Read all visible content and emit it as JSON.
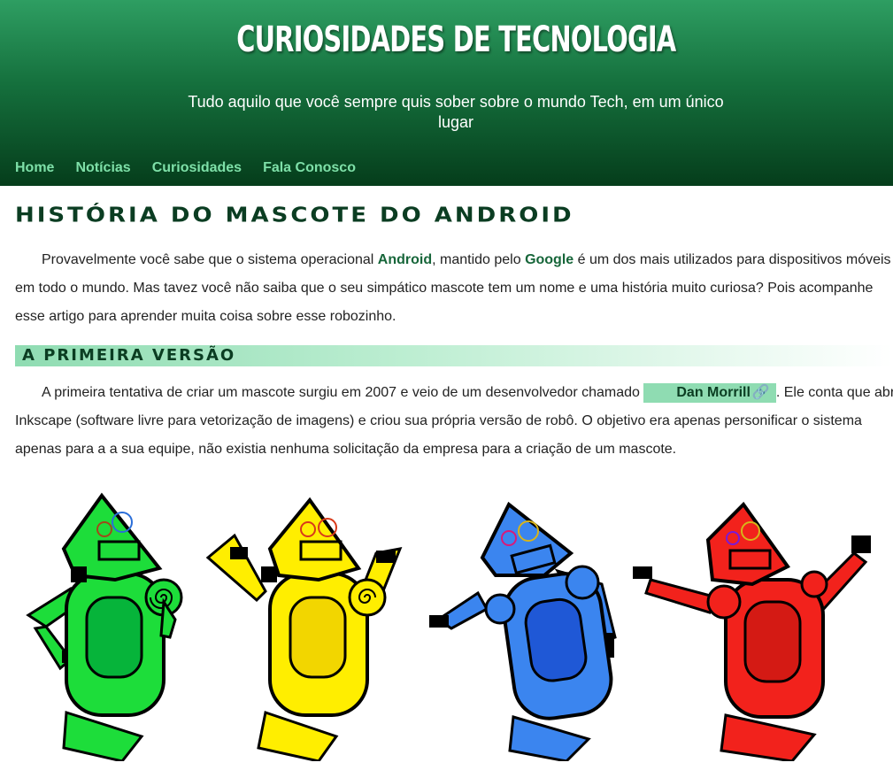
{
  "header": {
    "title": "CURIOSIDADES DE TECNOLOGIA",
    "subtitle": "Tudo aquilo que você sempre quis sober sobre o mundo Tech, em um único lugar"
  },
  "nav": {
    "items": [
      {
        "label": "Home"
      },
      {
        "label": "Notícias"
      },
      {
        "label": "Curiosidades"
      },
      {
        "label": "Fala Conosco"
      }
    ]
  },
  "article": {
    "title": "HISTÓRIA DO MASCOTE DO ANDROID",
    "intro": {
      "line1_a": "Provavelmente você sabe que o sistema operacional ",
      "line1_b": "Android",
      "line1_c": ", mantido pelo ",
      "line1_d": "Google",
      "line1_e": " é um dos mais utilizados para dispositivos móveis",
      "line2": "em todo o mundo. Mas tavez você não saiba que o seu simpático mascote tem um nome e uma história muito curiosa? Pois acompanhe",
      "line3": "esse artigo para aprender muita coisa sobre esse robozinho."
    },
    "section1": {
      "heading": "A PRIMEIRA VERSÃO",
      "line1_a": "A primeira tentativa de criar um mascote surgiu em 2007 e veio de um desenvolvedor chamado ",
      "link_label": "Dan Morrill",
      "line1_b": ". Ele conta que abriu o",
      "line2": "Inkscape (software livre para vetorização de imagens) e criou sua própria versão de robô. O objetivo era apenas personificar o sistema",
      "line3": "apenas para a a sua equipe, não existia nenhuma solicitação da empresa para a criação de um mascote."
    },
    "robots": [
      {
        "color": "#1ddd3a",
        "dark": "#0ba32b",
        "visor": "#06b43a"
      },
      {
        "color": "#ffee00",
        "dark": "#d8c400",
        "visor": "#f2d600"
      },
      {
        "color": "#3b85ef",
        "dark": "#2a63c4",
        "visor": "#1f58d6"
      },
      {
        "color": "#f2221c",
        "dark": "#c4150f",
        "visor": "#d41a14"
      }
    ]
  }
}
